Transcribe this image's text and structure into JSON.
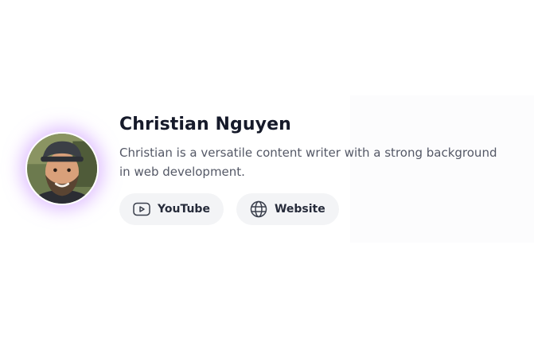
{
  "author": {
    "name": "Christian Nguyen",
    "bio": "Christian is a versatile content writer with a strong background in web development.",
    "avatar_icon": "profile-photo",
    "accent_glow": "#c48aff"
  },
  "links": [
    {
      "label": "YouTube",
      "icon": "youtube-icon"
    },
    {
      "label": "Website",
      "icon": "globe-icon"
    }
  ]
}
